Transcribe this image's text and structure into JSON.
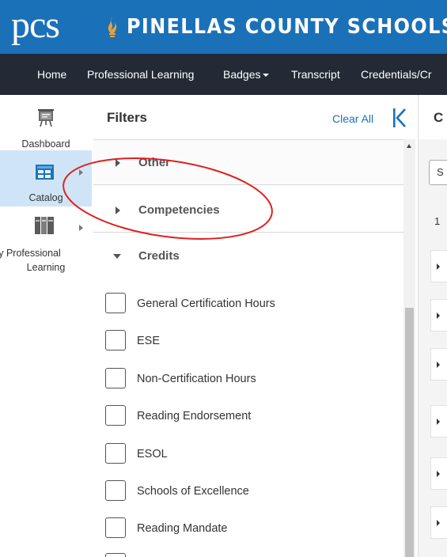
{
  "brand": {
    "logo_text": "PCS",
    "name": "PINELLAS COUNTY SCHOOLS",
    "colors": {
      "brand_blue": "#1a71b8",
      "nav_dark": "#232a36",
      "flame": "#e8a23a"
    }
  },
  "nav": {
    "items": [
      {
        "label": "Home"
      },
      {
        "label": "Professional Learning"
      },
      {
        "label": "Badges",
        "has_dropdown": true
      },
      {
        "label": "Transcript"
      },
      {
        "label": "Credentials/Cr"
      }
    ]
  },
  "rail": {
    "items": [
      {
        "label": "Dashboard",
        "icon": "presentation-board-icon",
        "active": false
      },
      {
        "label": "Catalog",
        "icon": "catalog-grid-icon",
        "active": true
      },
      {
        "label": "My Professional",
        "label2": "Learning",
        "label_prefix_visible": "/ly Professional",
        "icon": "books-icon",
        "active": false
      }
    ]
  },
  "filters": {
    "title": "Filters",
    "clear_all": "Clear All",
    "sections": [
      {
        "label": "Other",
        "expanded": false
      },
      {
        "label": "Competencies",
        "expanded": false
      },
      {
        "label": "Credits",
        "expanded": true
      }
    ],
    "credit_options": [
      {
        "label": "General Certification Hours",
        "checked": false
      },
      {
        "label": "ESE",
        "checked": false
      },
      {
        "label": "Non-Certification Hours",
        "checked": false
      },
      {
        "label": "Reading Endorsement",
        "checked": false
      },
      {
        "label": "ESOL",
        "checked": false
      },
      {
        "label": "Schools of Excellence",
        "checked": false
      },
      {
        "label": "Reading Mandate",
        "checked": false
      }
    ]
  },
  "content": {
    "title_fragment": "C",
    "search_fragment": "S",
    "count_fragment": "1"
  },
  "annotation": {
    "color": "#e02020"
  }
}
